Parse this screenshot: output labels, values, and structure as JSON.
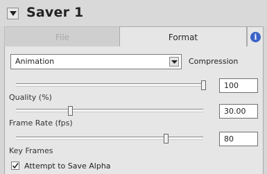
{
  "panel": {
    "title": "Saver 1",
    "collapse_icon": "triangle-down-icon"
  },
  "tabs": [
    {
      "label": "File",
      "active": false
    },
    {
      "label": "Format",
      "active": true
    }
  ],
  "info_button": {
    "icon": "info-icon",
    "glyph": "i",
    "color": "#3b63c6"
  },
  "compression": {
    "value": "Animation",
    "label": "Compression"
  },
  "sliders": [
    {
      "label": "Quality (%)",
      "value_text": "100",
      "level": 1.0
    },
    {
      "label": "Frame Rate (fps)",
      "value_text": "30.00",
      "level": 0.29
    },
    {
      "label": "Key Frames",
      "value_text": "80",
      "level": 0.8
    }
  ],
  "checkbox": {
    "label": "Attempt to Save Alpha",
    "checked": true
  }
}
